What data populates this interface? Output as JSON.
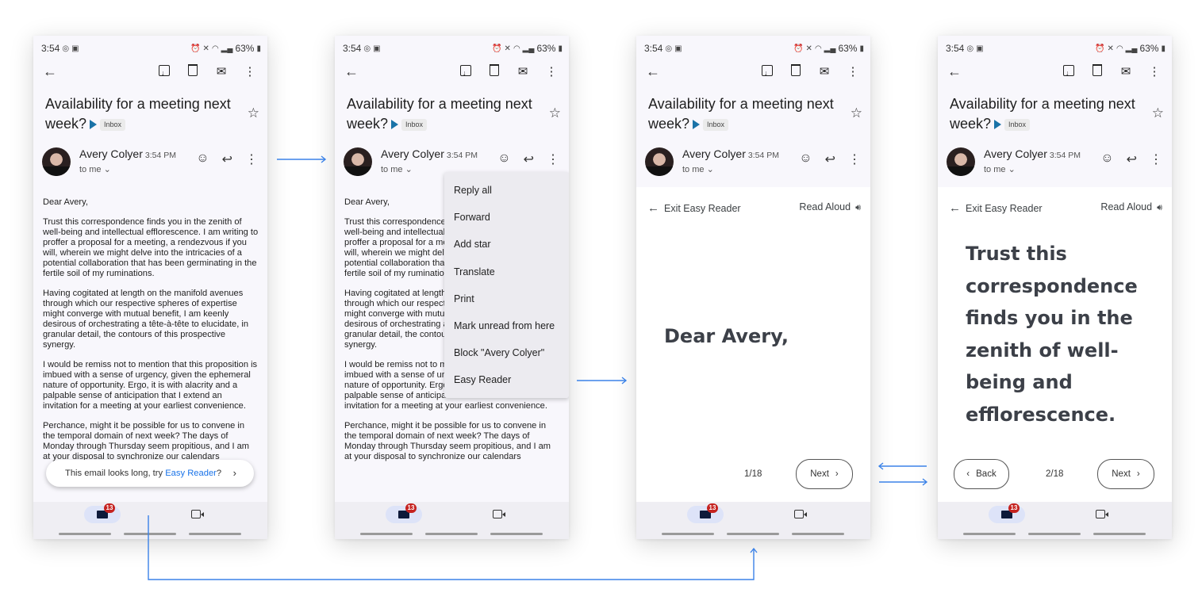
{
  "status_bar": {
    "time": "3:54",
    "battery": "63%"
  },
  "email": {
    "subject": "Availability for a meeting next week?",
    "label": "Inbox",
    "sender": "Avery Colyer",
    "time": "3:54 PM",
    "recipient": "to me",
    "body": [
      "Dear Avery,",
      "Trust this correspondence finds you in the zenith of well-being and intellectual efflorescence. I am writing to proffer a proposal for a meeting, a rendezvous if you will, wherein we might delve into the intricacies of a potential collaboration that has been germinating in the fertile soil of my ruminations.",
      "Having cogitated at length on the manifold avenues through which our respective spheres of expertise might converge with mutual benefit, I am keenly desirous of orchestrating a tête-à-tête to elucidate, in granular detail, the contours of this prospective synergy.",
      "I would be remiss not to mention that this proposition is imbued with a sense of urgency, given the ephemeral nature of opportunity. Ergo, it is with alacrity and a palpable sense of anticipation that I extend an invitation for a meeting at your earliest convenience.",
      "Perchance, might it be possible for us to convene in the temporal domain of next week? The days of Monday through Thursday seem propitious, and I am at your disposal to synchronize our calendars"
    ]
  },
  "toast": {
    "prefix": "This email looks long, try ",
    "link": "Easy Reader",
    "suffix": "?"
  },
  "menu": {
    "items": [
      "Reply all",
      "Forward",
      "Add star",
      "Translate",
      "Print",
      "Mark unread from here",
      "Block \"Avery Colyer\"",
      "Easy Reader"
    ]
  },
  "reader": {
    "exit_label": "Exit Easy Reader",
    "read_aloud_label": "Read Aloud",
    "back_label": "Back",
    "next_label": "Next",
    "page1": {
      "text": "Dear Avery,",
      "indicator": "1/18"
    },
    "page2": {
      "text": "Trust this correspondence finds you in the zenith of well-being and efflorescence.",
      "indicator": "2/18"
    }
  },
  "nav": {
    "mail_badge": "13"
  },
  "colors": {
    "accent": "#1a73e8",
    "arrow": "#3b82e8",
    "badge": "#c5221f",
    "label": "#1a73a8"
  }
}
